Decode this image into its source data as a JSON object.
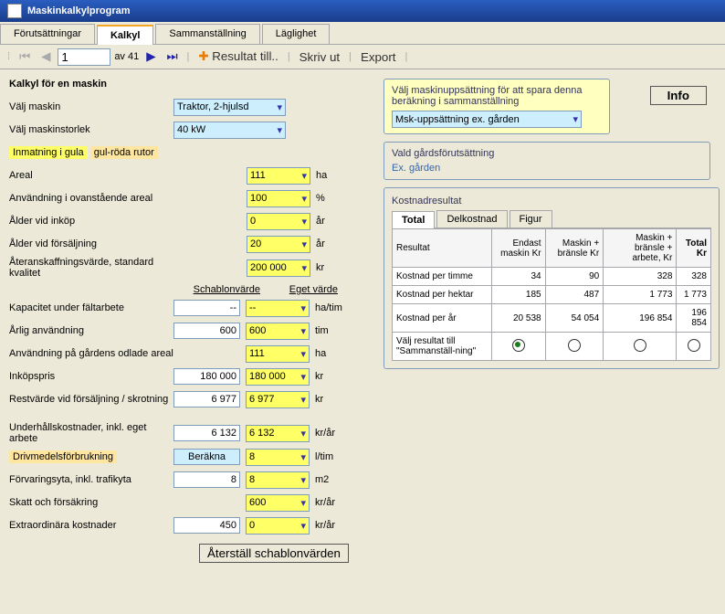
{
  "title": "Maskinkalkylprogram",
  "tabs": [
    "Förutsättningar",
    "Kalkyl",
    "Sammanställning",
    "Läglighet"
  ],
  "nav": {
    "pos": "1",
    "of": "av 41",
    "resultTill": "Resultat till..",
    "skrivUt": "Skriv ut",
    "export": "Export"
  },
  "h1": "Kalkyl för en maskin",
  "machine": {
    "lab": "Välj maskin",
    "val": "Traktor, 2-hjulsd"
  },
  "size": {
    "lab": "Välj maskinstorlek",
    "val": "40  kW"
  },
  "hint1": "Inmatning i gula",
  "hint2": "gul-röda rutor",
  "rows": [
    {
      "lab": "Areal",
      "own": "111",
      "unit": "ha"
    },
    {
      "lab": "Användning i ovanstående areal",
      "own": "100",
      "unit": "%"
    },
    {
      "lab": "Ålder vid inköp",
      "own": "0",
      "unit": "år"
    },
    {
      "lab": "Ålder vid försäljning",
      "own": "20",
      "unit": "år"
    },
    {
      "lab": "Återanskaffningsvärde,\n   standard kvalitet",
      "own": "200 000",
      "unit": "kr"
    }
  ],
  "colHdr": {
    "sch": "Schablonvärde",
    "own": "Eget värde"
  },
  "rows2": [
    {
      "lab": "Kapacitet under fältarbete",
      "sch": "--",
      "own": "--",
      "combo": true,
      "unit": "ha/tim"
    },
    {
      "lab": "Årlig användning",
      "sch": "600",
      "own": "600",
      "unit": "tim"
    },
    {
      "lab": "Användning på gårdens odlade areal",
      "sch": "",
      "own": "111",
      "unit": "ha",
      "noSch": true
    },
    {
      "lab": "Inköpspris",
      "sch": "180 000",
      "own": "180 000",
      "unit": "kr"
    },
    {
      "lab": "Restvärde vid försäljning / skrotning",
      "sch": "6 977",
      "own": "6 977",
      "unit": "kr"
    }
  ],
  "rows3": [
    {
      "lab": "Underhållskostnader, inkl. eget arbete",
      "sch": "6 132",
      "own": "6 132",
      "unit": "kr/år"
    },
    {
      "lab": "Drivmedelsförbrukning",
      "sch": "Beräkna",
      "own": "8",
      "unit": "l/tim",
      "btn": true,
      "hlLab": true
    },
    {
      "lab": "Förvaringsyta, inkl. trafikyta",
      "sch": "8",
      "own": "8",
      "unit": "m2"
    },
    {
      "lab": "Skatt och försäkring",
      "sch": "",
      "own": "600",
      "unit": "kr/år",
      "noSch": true
    },
    {
      "lab": "Extraordinära kostnader",
      "sch": "450",
      "own": "0",
      "unit": "kr/år"
    }
  ],
  "resetBtn": "Återställ schablonvärden",
  "sel": {
    "intro": "Välj maskinuppsättning för att spara denna beräkning i sammanställning",
    "val": "Msk-uppsättning ex. gården"
  },
  "farm": {
    "title": "Vald gårdsförutsättning",
    "val": "Ex. gården"
  },
  "info": "Info",
  "res": {
    "title": "Kostnadresultat",
    "tabs": [
      "Total",
      "Delkostnad",
      "Figur"
    ],
    "hdr": [
      "Resultat",
      "Endast maskin Kr",
      "Maskin + bränsle Kr",
      "Maskin + bränsle + arbete, Kr",
      "Total Kr"
    ],
    "rows": [
      {
        "l": "Kostnad per timme",
        "c": [
          "34",
          "90",
          "328",
          "328"
        ]
      },
      {
        "l": "Kostnad per hektar",
        "c": [
          "185",
          "487",
          "1 773",
          "1 773"
        ]
      },
      {
        "l": "Kostnad per år",
        "c": [
          "20 538",
          "54 054",
          "196 854",
          "196 854"
        ]
      }
    ],
    "radioRow": "Välj resultat  till \"Sammanställ-ning\"",
    "radio": [
      true,
      false,
      false,
      false
    ]
  }
}
